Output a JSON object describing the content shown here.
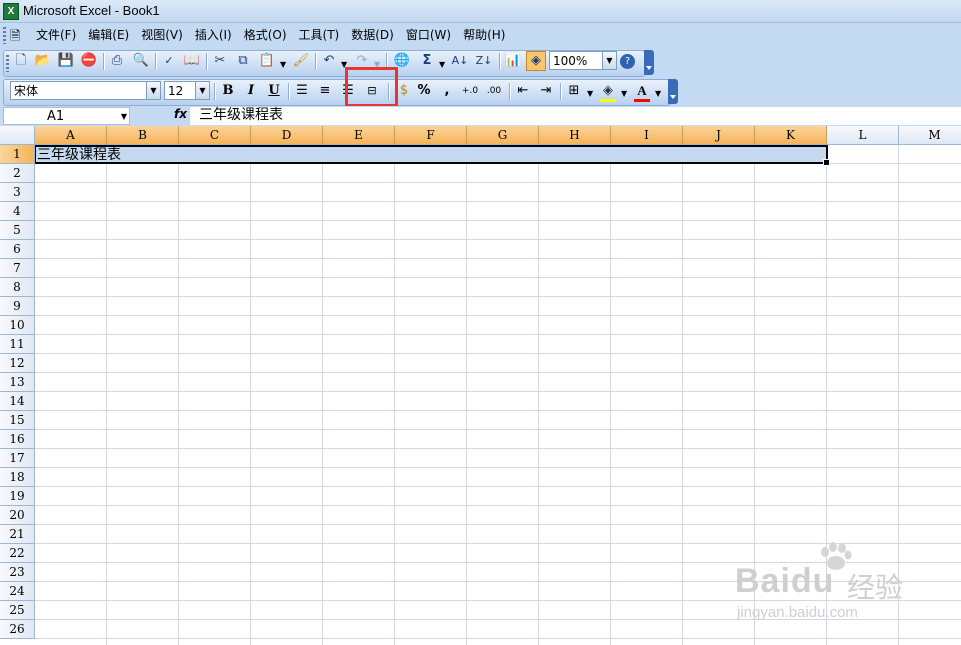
{
  "window": {
    "title": "Microsoft Excel - Book1",
    "app_icon_glyph": "X"
  },
  "menubar": {
    "items": [
      "文件(F)",
      "编辑(E)",
      "视图(V)",
      "插入(I)",
      "格式(O)",
      "工具(T)",
      "数据(D)",
      "窗口(W)",
      "帮助(H)"
    ]
  },
  "standard_toolbar": {
    "zoom_value": "100%",
    "icons": [
      "new-icon",
      "open-icon",
      "save-icon",
      "permission-icon",
      "print-icon",
      "print-preview-icon",
      "spelling-icon",
      "research-icon",
      "cut-icon",
      "copy-icon",
      "paste-icon",
      "format-painter-icon",
      "undo-icon",
      "redo-icon",
      "hyperlink-icon",
      "autosum-icon",
      "sort-ascending-icon",
      "sort-descending-icon",
      "chart-wizard-icon",
      "drawing-icon",
      "help-icon"
    ]
  },
  "formatting_toolbar": {
    "font_name": "宋体",
    "font_size": "12",
    "bold_label": "B",
    "italic_label": "I",
    "underline_label": "U",
    "percent_label": "%",
    "comma_label": ",",
    "highlighted_button": "merge-and-center-button",
    "fill_color": "#ffff00",
    "font_color": "#ff0000"
  },
  "formula_bar": {
    "name_box": "A1",
    "fx_label": "fx",
    "content": "三年级课程表"
  },
  "sheet": {
    "columns": [
      "A",
      "B",
      "C",
      "D",
      "E",
      "F",
      "G",
      "H",
      "I",
      "J",
      "K",
      "L",
      "M"
    ],
    "selected_columns": [
      "A",
      "B",
      "C",
      "D",
      "E",
      "F",
      "G",
      "H",
      "I",
      "J",
      "K"
    ],
    "rows": [
      "1",
      "2",
      "3",
      "4",
      "5",
      "6",
      "7",
      "8",
      "9",
      "10",
      "11",
      "12",
      "13",
      "14",
      "15",
      "16",
      "17",
      "18",
      "19",
      "20",
      "21",
      "22",
      "23",
      "24",
      "25",
      "26"
    ],
    "selected_row": "1",
    "selection_range": "A1:K1",
    "cells": {
      "A1": "三年级课程表"
    }
  },
  "colors": {
    "titlebar": "#c3d8ef",
    "toolbar": "#c4daf3",
    "header_selected": "#f5b35a",
    "selection_fill": "#c5daf1",
    "highlight_box": "#ea3333"
  },
  "watermark": {
    "logo_text": "Baidu",
    "cn_text": "经验",
    "url": "jingyan.baidu.com"
  }
}
